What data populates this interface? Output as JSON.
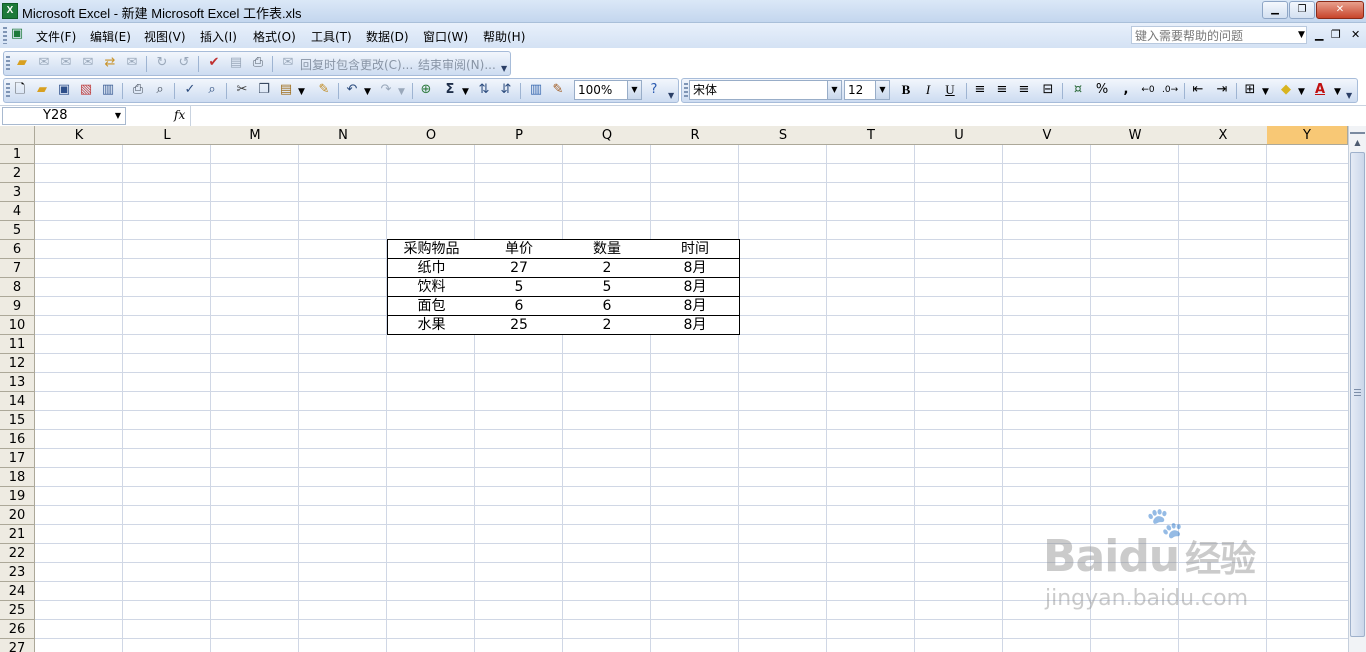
{
  "window": {
    "title": "Microsoft Excel - 新建 Microsoft Excel 工作表.xls",
    "icon": "excel-icon"
  },
  "menu": {
    "items": [
      "文件(F)",
      "编辑(E)",
      "视图(V)",
      "插入(I)",
      "格式(O)",
      "工具(T)",
      "数据(D)",
      "窗口(W)",
      "帮助(H)"
    ],
    "help_placeholder": "键入需要帮助的问题"
  },
  "reviewing_toolbar": {
    "reply_changes": "回复时包含更改(C)...",
    "end_review": "结束审阅(N)..."
  },
  "standard_toolbar": {
    "zoom": "100%"
  },
  "formatting_toolbar": {
    "font": "宋体",
    "font_size": "12",
    "bold": "B",
    "italic": "I",
    "underline": "U",
    "percent": "%",
    "comma": ","
  },
  "formula_bar": {
    "name_box": "Y28",
    "fx_label": "fx",
    "formula": ""
  },
  "sheet": {
    "columns": [
      "K",
      "L",
      "M",
      "N",
      "O",
      "P",
      "Q",
      "R",
      "S",
      "T",
      "U",
      "V",
      "W",
      "X",
      "Y"
    ],
    "selected_column": "Y",
    "rows": [
      "1",
      "2",
      "3",
      "4",
      "5",
      "6",
      "7",
      "8",
      "9",
      "10",
      "11",
      "12",
      "13",
      "14",
      "15",
      "16",
      "17",
      "18",
      "19",
      "20",
      "21",
      "22",
      "23",
      "24",
      "25",
      "26",
      "27"
    ],
    "table": {
      "headers": [
        "采购物品",
        "单价",
        "数量",
        "时间"
      ],
      "rows": [
        [
          "纸巾",
          "27",
          "2",
          "8月"
        ],
        [
          "饮料",
          "5",
          "5",
          "8月"
        ],
        [
          "面包",
          "6",
          "6",
          "8月"
        ],
        [
          "水果",
          "25",
          "2",
          "8月"
        ]
      ]
    }
  },
  "watermark": {
    "main": "Bai",
    "main2": "du",
    "suffix": "经验",
    "url": "jingyan.baidu.com"
  }
}
